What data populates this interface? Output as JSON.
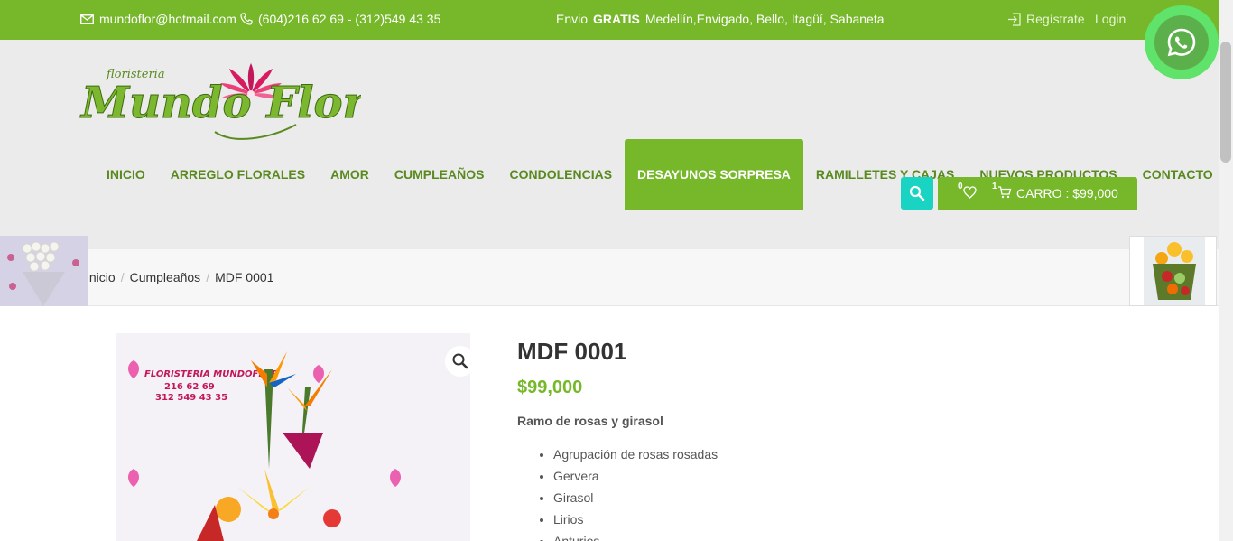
{
  "topbar": {
    "email": "mundoflor@hotmail.com",
    "phone": "(604)216 62 69 - (312)549 43 35",
    "shipping_bold": "GRATIS",
    "shipping_prefix": "Envio",
    "shipping_rest": "Medellín,Envigado, Bello, Itagüí, Sabaneta",
    "register": "Regístrate",
    "login": "Login"
  },
  "logo": {
    "small_text": "floristeria",
    "main_text": "Mundo Flor"
  },
  "nav": {
    "items": [
      {
        "label": "INICIO"
      },
      {
        "label": "ARREGLO FLORALES"
      },
      {
        "label": "AMOR"
      },
      {
        "label": "CUMPLEAÑOS"
      },
      {
        "label": "CONDOLENCIAS"
      },
      {
        "label": "DESAYUNOS SORPRESA",
        "active": true
      },
      {
        "label": "RAMILLETES Y CAJAS"
      },
      {
        "label": "NUEVOS PRODUCTOS"
      },
      {
        "label": "CONTACTO"
      }
    ]
  },
  "cart": {
    "wishlist_count": "0",
    "cart_count": "1",
    "label": "CARRO : $99,000"
  },
  "breadcrumb": {
    "home": "Inicio",
    "category": "Cumpleaños",
    "current": "MDF 0001",
    "separator": "/"
  },
  "product": {
    "title": "MDF 0001",
    "price": "$99,000",
    "description_title": "Ramo de rosas y girasol",
    "features": [
      "Agrupación de rosas rosadas",
      "Gervera",
      "Girasol",
      "Lirios",
      "Anturios"
    ],
    "image_watermark": {
      "brand": "FLORISTERIA MUNDOFLOR",
      "phone1": "216 62 69",
      "phone2": "312 549 43 35"
    }
  },
  "colors": {
    "brand_green": "#76b82a",
    "nav_text": "#5a8a1f",
    "search_teal": "#19d4c2",
    "whatsapp": "#5bb04b"
  },
  "icons": {
    "email": "envelope-icon",
    "phone": "phone-icon",
    "register": "login-arrow-icon",
    "search": "search-icon",
    "wishlist": "heart-icon",
    "cart": "cart-icon",
    "zoom": "magnifier-icon",
    "whatsapp": "whatsapp-icon"
  }
}
